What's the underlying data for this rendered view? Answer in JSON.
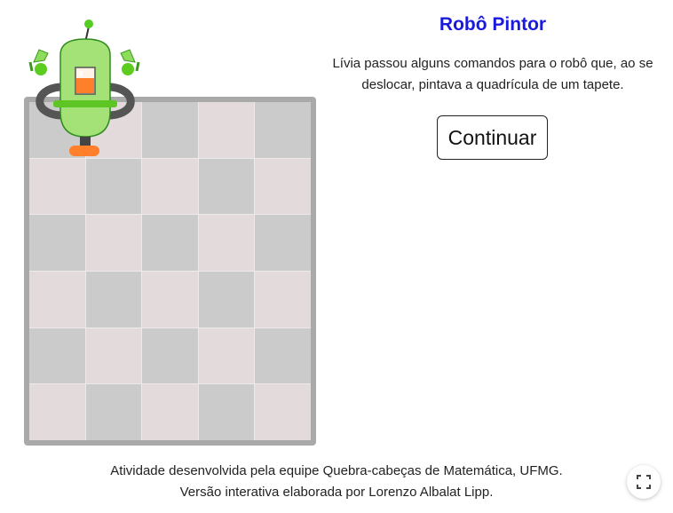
{
  "activity": {
    "title": "Robô Pintor",
    "description": "Lívia passou alguns comandos para o robô que, ao se deslocar, pintava a quadrícula de um tapete.",
    "continue_label": "Continuar"
  },
  "board": {
    "columns": 5,
    "rows": 6,
    "cell_colors": {
      "gray": "#cbcbcb",
      "pink": "#e3dbdb"
    },
    "frame_color": "#a9a9a9"
  },
  "robot": {
    "body_color": "#a4e277",
    "outline_color": "#2e8b1e",
    "tank_color": "#ff7f2a",
    "foot_color": "#ff7f2a",
    "arm_color": "#555555"
  },
  "footer": {
    "line1": "Atividade desenvolvida pela equipe Quebra-cabeças de Matemática, UFMG.",
    "line2": "Versão interativa elaborada por Lorenzo Albalat Lipp."
  },
  "icons": {
    "fullscreen": "fullscreen-icon",
    "robot": "robot-icon"
  }
}
